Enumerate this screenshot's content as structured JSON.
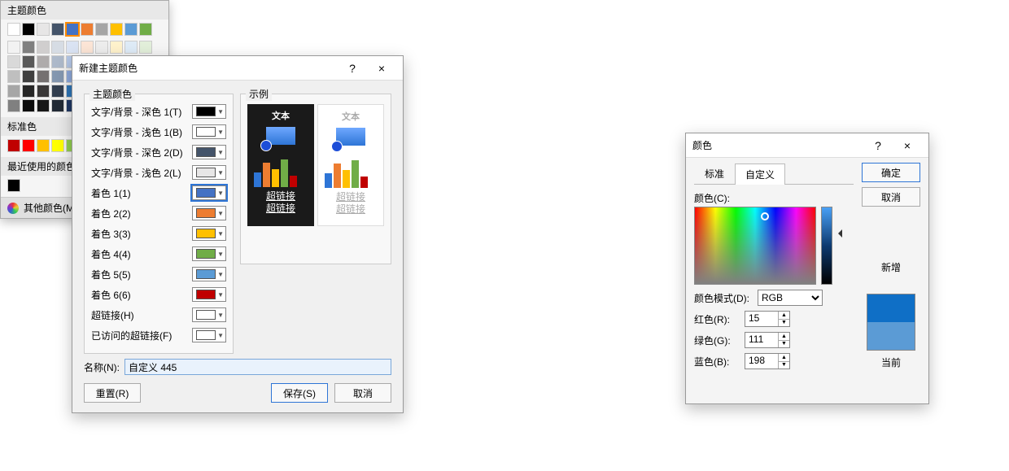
{
  "dialog1": {
    "title": "新建主题颜色",
    "help_char": "?",
    "close_char": "×",
    "themecolors_label": "主题颜色",
    "sample_label": "示例",
    "slots": [
      {
        "label": "文字/背景 - 深色 1(T)",
        "color": "#000000"
      },
      {
        "label": "文字/背景 - 浅色 1(B)",
        "color": "#ffffff"
      },
      {
        "label": "文字/背景 - 深色 2(D)",
        "color": "#44546a"
      },
      {
        "label": "文字/背景 - 浅色 2(L)",
        "color": "#e7e6e6"
      },
      {
        "label": "着色 1(1)",
        "color": "#4472c4",
        "selected": true
      },
      {
        "label": "着色 2(2)",
        "color": "#ed7d31"
      },
      {
        "label": "着色 3(3)",
        "color": "#ffc000"
      },
      {
        "label": "着色 4(4)",
        "color": "#70ad47"
      },
      {
        "label": "着色 5(5)",
        "color": "#5b9bd5"
      },
      {
        "label": "着色 6(6)",
        "color": "#c00000"
      },
      {
        "label": "超链接(H)",
        "color": "#ffffff"
      },
      {
        "label": "已访问的超链接(F)",
        "color": "#ffffff"
      }
    ],
    "sample_text": "文本",
    "sample_link1": "超链接",
    "sample_link2": "超链接",
    "sample_link1b": "超链接",
    "sample_link2b": "超链接",
    "bars_colors": [
      "#2e75d6",
      "#ed7d31",
      "#ffc000",
      "#70ad47",
      "#c00000"
    ],
    "name_label": "名称(N):",
    "name_value": "自定义 445",
    "reset_btn": "重置(R)",
    "save_btn": "保存(S)",
    "cancel_btn": "取消"
  },
  "popup": {
    "title_theme": "主题颜色",
    "title_standard": "标准色",
    "title_recent": "最近使用的颜色",
    "more": "其他颜色(M)...",
    "theme_row1": [
      "#ffffff",
      "#000000",
      "#e7e6e6",
      "#44546a",
      "#4472c4",
      "#ed7d31",
      "#a5a5a5",
      "#ffc000",
      "#5b9bd5",
      "#70ad47"
    ],
    "theme_shades": [
      [
        "#f2f2f2",
        "#7f7f7f",
        "#d0cece",
        "#d6dce4",
        "#dae3f3",
        "#fce5d6",
        "#ededed",
        "#fff2cc",
        "#deebf7",
        "#e2efda"
      ],
      [
        "#d9d9d9",
        "#595959",
        "#aeabab",
        "#adb9ca",
        "#b4c7e7",
        "#f8cbad",
        "#dbdbdb",
        "#ffe699",
        "#bdd7ee",
        "#c5e0b4"
      ],
      [
        "#bfbfbf",
        "#3f3f3f",
        "#757171",
        "#8497b0",
        "#8faadc",
        "#f4b183",
        "#c9c9c9",
        "#ffd966",
        "#9dc3e6",
        "#a9d18e"
      ],
      [
        "#a6a6a6",
        "#262626",
        "#3a3838",
        "#333f50",
        "#2e75b6",
        "#c55a11",
        "#7b7b7b",
        "#bf9000",
        "#2e75b6",
        "#548235"
      ],
      [
        "#808080",
        "#0d0d0d",
        "#171717",
        "#222a35",
        "#203864",
        "#843c0c",
        "#525252",
        "#7f6000",
        "#1f4e79",
        "#385723"
      ]
    ],
    "standard": [
      "#c00000",
      "#ff0000",
      "#ffc000",
      "#ffff00",
      "#92d050",
      "#00b050",
      "#00b0f0",
      "#0070c0",
      "#002060",
      "#7030a0"
    ],
    "recent": [
      "#000000"
    ],
    "current_accent_index": 4
  },
  "dialog3": {
    "title": "颜色",
    "tab_standard": "标准",
    "tab_custom": "自定义",
    "color_label": "颜色(C):",
    "mode_label": "颜色模式(D):",
    "mode_value": "RGB",
    "r_label": "红色(R):",
    "g_label": "绿色(G):",
    "b_label": "蓝色(B):",
    "r": 15,
    "g": 111,
    "b": 198,
    "ok": "确定",
    "cancel": "取消",
    "new_label": "新增",
    "current_label": "当前",
    "new_color": "#0f6fc6",
    "current_color": "#5b9bd5"
  }
}
